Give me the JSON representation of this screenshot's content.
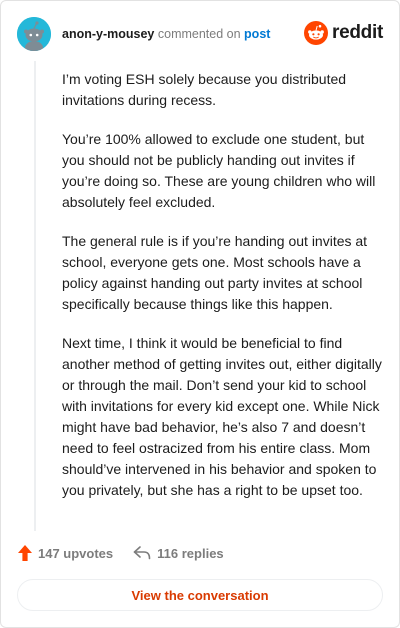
{
  "header": {
    "username": "anon-y-mousey",
    "commented_on": "commented on",
    "post_link": "post",
    "logo_text": "reddit"
  },
  "comment": {
    "paragraphs": [
      "I’m voting ESH solely because you distributed invitations during recess.",
      "You’re 100% allowed to exclude one student, but you should not be publicly handing out invites if you’re doing so. These are young children who will absolutely feel excluded.",
      "The general rule is if you’re handing out invites at school, everyone gets one. Most schools have a policy against handing out party invites at school specifically because things like this happen.",
      "Next time, I think it would be beneficial to find another method of getting invites out, either digitally or through the mail. Don’t send your kid to school with invitations for every kid except one. While Nick might have bad behavior, he’s also 7 and doesn’t need to feel ostracized from his entire class. Mom should’ve intervened in his behavior and spoken to you privately, but she has a right to be upset too."
    ]
  },
  "actions": {
    "upvotes": "147 upvotes",
    "replies": "116 replies"
  },
  "footer": {
    "view_conversation": "View the conversation"
  },
  "colors": {
    "avatar_bg": "#24b8d9",
    "reddit_orange": "#ff4500",
    "link_blue": "#0079d3",
    "button_text": "#d93a00"
  },
  "icons": {
    "avatar": "snoo-avatar-icon",
    "logo": "reddit-logo-icon",
    "upvote": "upvote-arrow-icon",
    "reply": "reply-arrow-icon"
  }
}
